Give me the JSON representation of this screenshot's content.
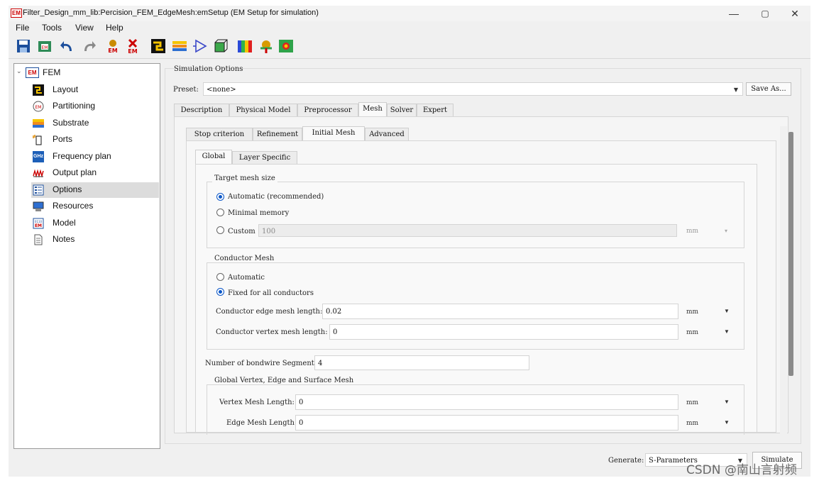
{
  "window": {
    "title": "Filter_Design_mm_lib:Percision_FEM_EdgeMesh:emSetup (EM Setup for simulation)",
    "icon_text": "EM",
    "controls": {
      "minimize": "—",
      "restore": "▢",
      "close": "✕"
    }
  },
  "menu": {
    "items": [
      "File",
      "Tools",
      "View",
      "Help"
    ]
  },
  "toolbar": {
    "icons": [
      "save-icon",
      "em-export-icon",
      "undo-icon",
      "redo-icon",
      "em-generate-icon",
      "em-remove-icon",
      "layout-icon",
      "substrate-icon",
      "port-icon",
      "box-3d-icon",
      "colors-icon",
      "anchor-icon",
      "map-icon"
    ]
  },
  "tree": {
    "root_label": "FEM",
    "root_icon_text": "EM",
    "items": [
      {
        "label": "Layout",
        "icon": "layout-icon"
      },
      {
        "label": "Partitioning",
        "icon": "partitioning-icon"
      },
      {
        "label": "Substrate",
        "icon": "substrate-icon"
      },
      {
        "label": "Ports",
        "icon": "ports-icon"
      },
      {
        "label": "Frequency plan",
        "icon": "frequency-icon",
        "icon_text": "GHz"
      },
      {
        "label": "Output plan",
        "icon": "output-plan-icon"
      },
      {
        "label": "Options",
        "icon": "options-icon",
        "selected": true
      },
      {
        "label": "Resources",
        "icon": "resources-icon"
      },
      {
        "label": "Model",
        "icon": "model-icon"
      },
      {
        "label": "Notes",
        "icon": "notes-icon"
      }
    ]
  },
  "main": {
    "section_title": "Simulation Options",
    "preset_label": "Preset:",
    "preset_value": "<none>",
    "save_as_label": "Save As...",
    "tabs": [
      "Description",
      "Physical Model",
      "Preprocessor",
      "Mesh",
      "Solver",
      "Expert"
    ],
    "subtabs": [
      "Stop criterion",
      "Refinement",
      "Initial Mesh",
      "Advanced"
    ],
    "subsubtabs": [
      "Global",
      "Layer Specific"
    ],
    "target_mesh": {
      "title": "Target mesh size",
      "options": [
        "Automatic (recommended)",
        "Minimal memory",
        "Custom"
      ],
      "custom_value": "100",
      "custom_unit": "mm"
    },
    "conductor_mesh": {
      "title": "Conductor Mesh",
      "options": [
        "Automatic",
        "Fixed for all conductors"
      ],
      "edge_label": "Conductor edge mesh length:",
      "edge_value": "0.02",
      "edge_unit": "mm",
      "vertex_label": "Conductor vertex mesh length:",
      "vertex_value": "0",
      "vertex_unit": "mm"
    },
    "bondwire_label": "Number of bondwire Segments:",
    "bondwire_value": "4",
    "global_mesh": {
      "title": "Global Vertex, Edge and Surface Mesh",
      "vertex_label": "Vertex Mesh Length:",
      "vertex_value": "0",
      "vertex_unit": "mm",
      "edge_label": "Edge Mesh Length:",
      "edge_value": "0",
      "edge_unit": "mm"
    }
  },
  "footer": {
    "generate_label": "Generate:",
    "generate_value": "S-Parameters",
    "simulate_label": "Simulate"
  },
  "watermark": "CSDN @南山言射频",
  "colors": {
    "accent": "#0b57c8",
    "selection": "#dcdcdc",
    "close_red": "#c00000"
  }
}
